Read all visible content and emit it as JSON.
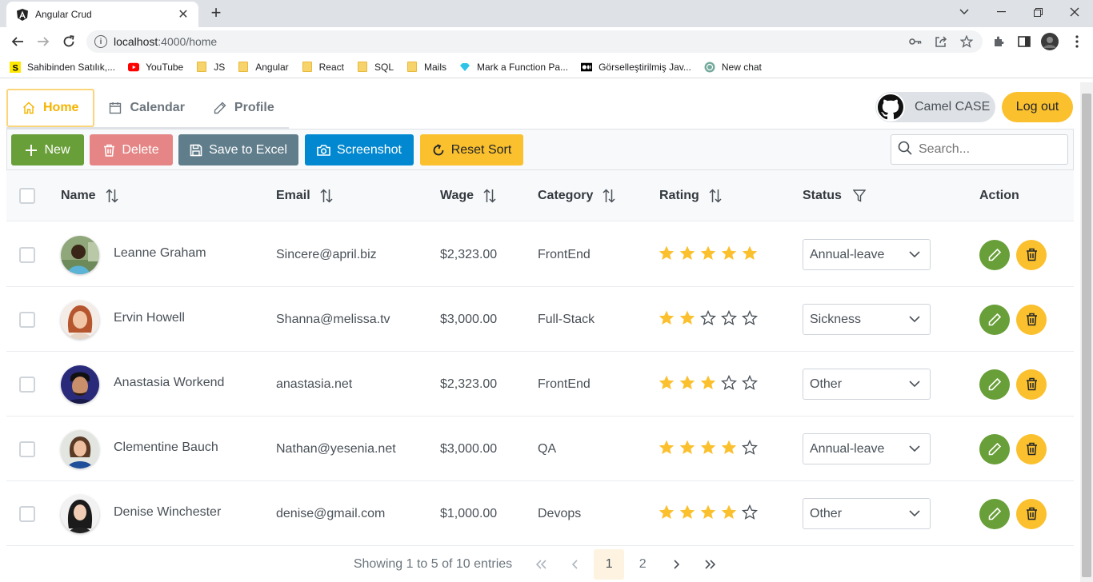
{
  "browser": {
    "tab_title": "Angular Crud",
    "url_host": "localhost",
    "url_path": ":4000/home",
    "bookmarks": [
      {
        "label": "Sahibinden Satılık,...",
        "icon": "sahibinden-icon"
      },
      {
        "label": "YouTube",
        "icon": "youtube-icon"
      },
      {
        "label": "JS",
        "icon": "folder-icon"
      },
      {
        "label": "Angular",
        "icon": "folder-icon"
      },
      {
        "label": "React",
        "icon": "folder-icon"
      },
      {
        "label": "SQL",
        "icon": "folder-icon"
      },
      {
        "label": "Mails",
        "icon": "folder-icon"
      },
      {
        "label": "Mark a Function Pa...",
        "icon": "diamond-icon"
      },
      {
        "label": "Görselleştirilmiş Jav...",
        "icon": "medium-icon"
      },
      {
        "label": "New chat",
        "icon": "chatgpt-icon"
      }
    ]
  },
  "menu": {
    "items": [
      {
        "label": "Home",
        "icon": "home-icon",
        "active": true
      },
      {
        "label": "Calendar",
        "icon": "calendar-icon"
      },
      {
        "label": "Profile",
        "icon": "pencil-icon"
      }
    ]
  },
  "user": {
    "name": "Camel CASE",
    "logout_label": "Log out"
  },
  "toolbar": {
    "new_label": "New",
    "delete_label": "Delete",
    "excel_label": "Save to Excel",
    "screenshot_label": "Screenshot",
    "reset_label": "Reset Sort",
    "search_placeholder": "Search..."
  },
  "table": {
    "headers": {
      "name": "Name",
      "email": "Email",
      "wage": "Wage",
      "category": "Category",
      "rating": "Rating",
      "status": "Status",
      "action": "Action"
    },
    "rows": [
      {
        "name": "Leanne Graham",
        "email": "Sincere@april.biz",
        "wage": "$2,323.00",
        "category": "FrontEnd",
        "rating": 5,
        "status": "Annual-leave"
      },
      {
        "name": "Ervin Howell",
        "email": "Shanna@melissa.tv",
        "wage": "$3,000.00",
        "category": "Full-Stack",
        "rating": 2,
        "status": "Sickness"
      },
      {
        "name": "Anastasia Workend",
        "email": "anastasia.net",
        "wage": "$2,323.00",
        "category": "FrontEnd",
        "rating": 3,
        "status": "Other"
      },
      {
        "name": "Clementine Bauch",
        "email": "Nathan@yesenia.net",
        "wage": "$3,000.00",
        "category": "QA",
        "rating": 4,
        "status": "Annual-leave"
      },
      {
        "name": "Denise Winchester",
        "email": "denise@gmail.com",
        "wage": "$1,000.00",
        "category": "Devops",
        "rating": 4,
        "status": "Other"
      }
    ]
  },
  "paginator": {
    "info": "Showing 1 to 5 of 10 entries",
    "pages": [
      "1",
      "2"
    ],
    "current": "1"
  },
  "colors": {
    "primary_yellow": "#fbc02d",
    "green": "#689f38",
    "red_disabled": "#e57f7f",
    "slate": "#607d8b",
    "blue": "#0288d1",
    "star": "#fbc02d"
  }
}
